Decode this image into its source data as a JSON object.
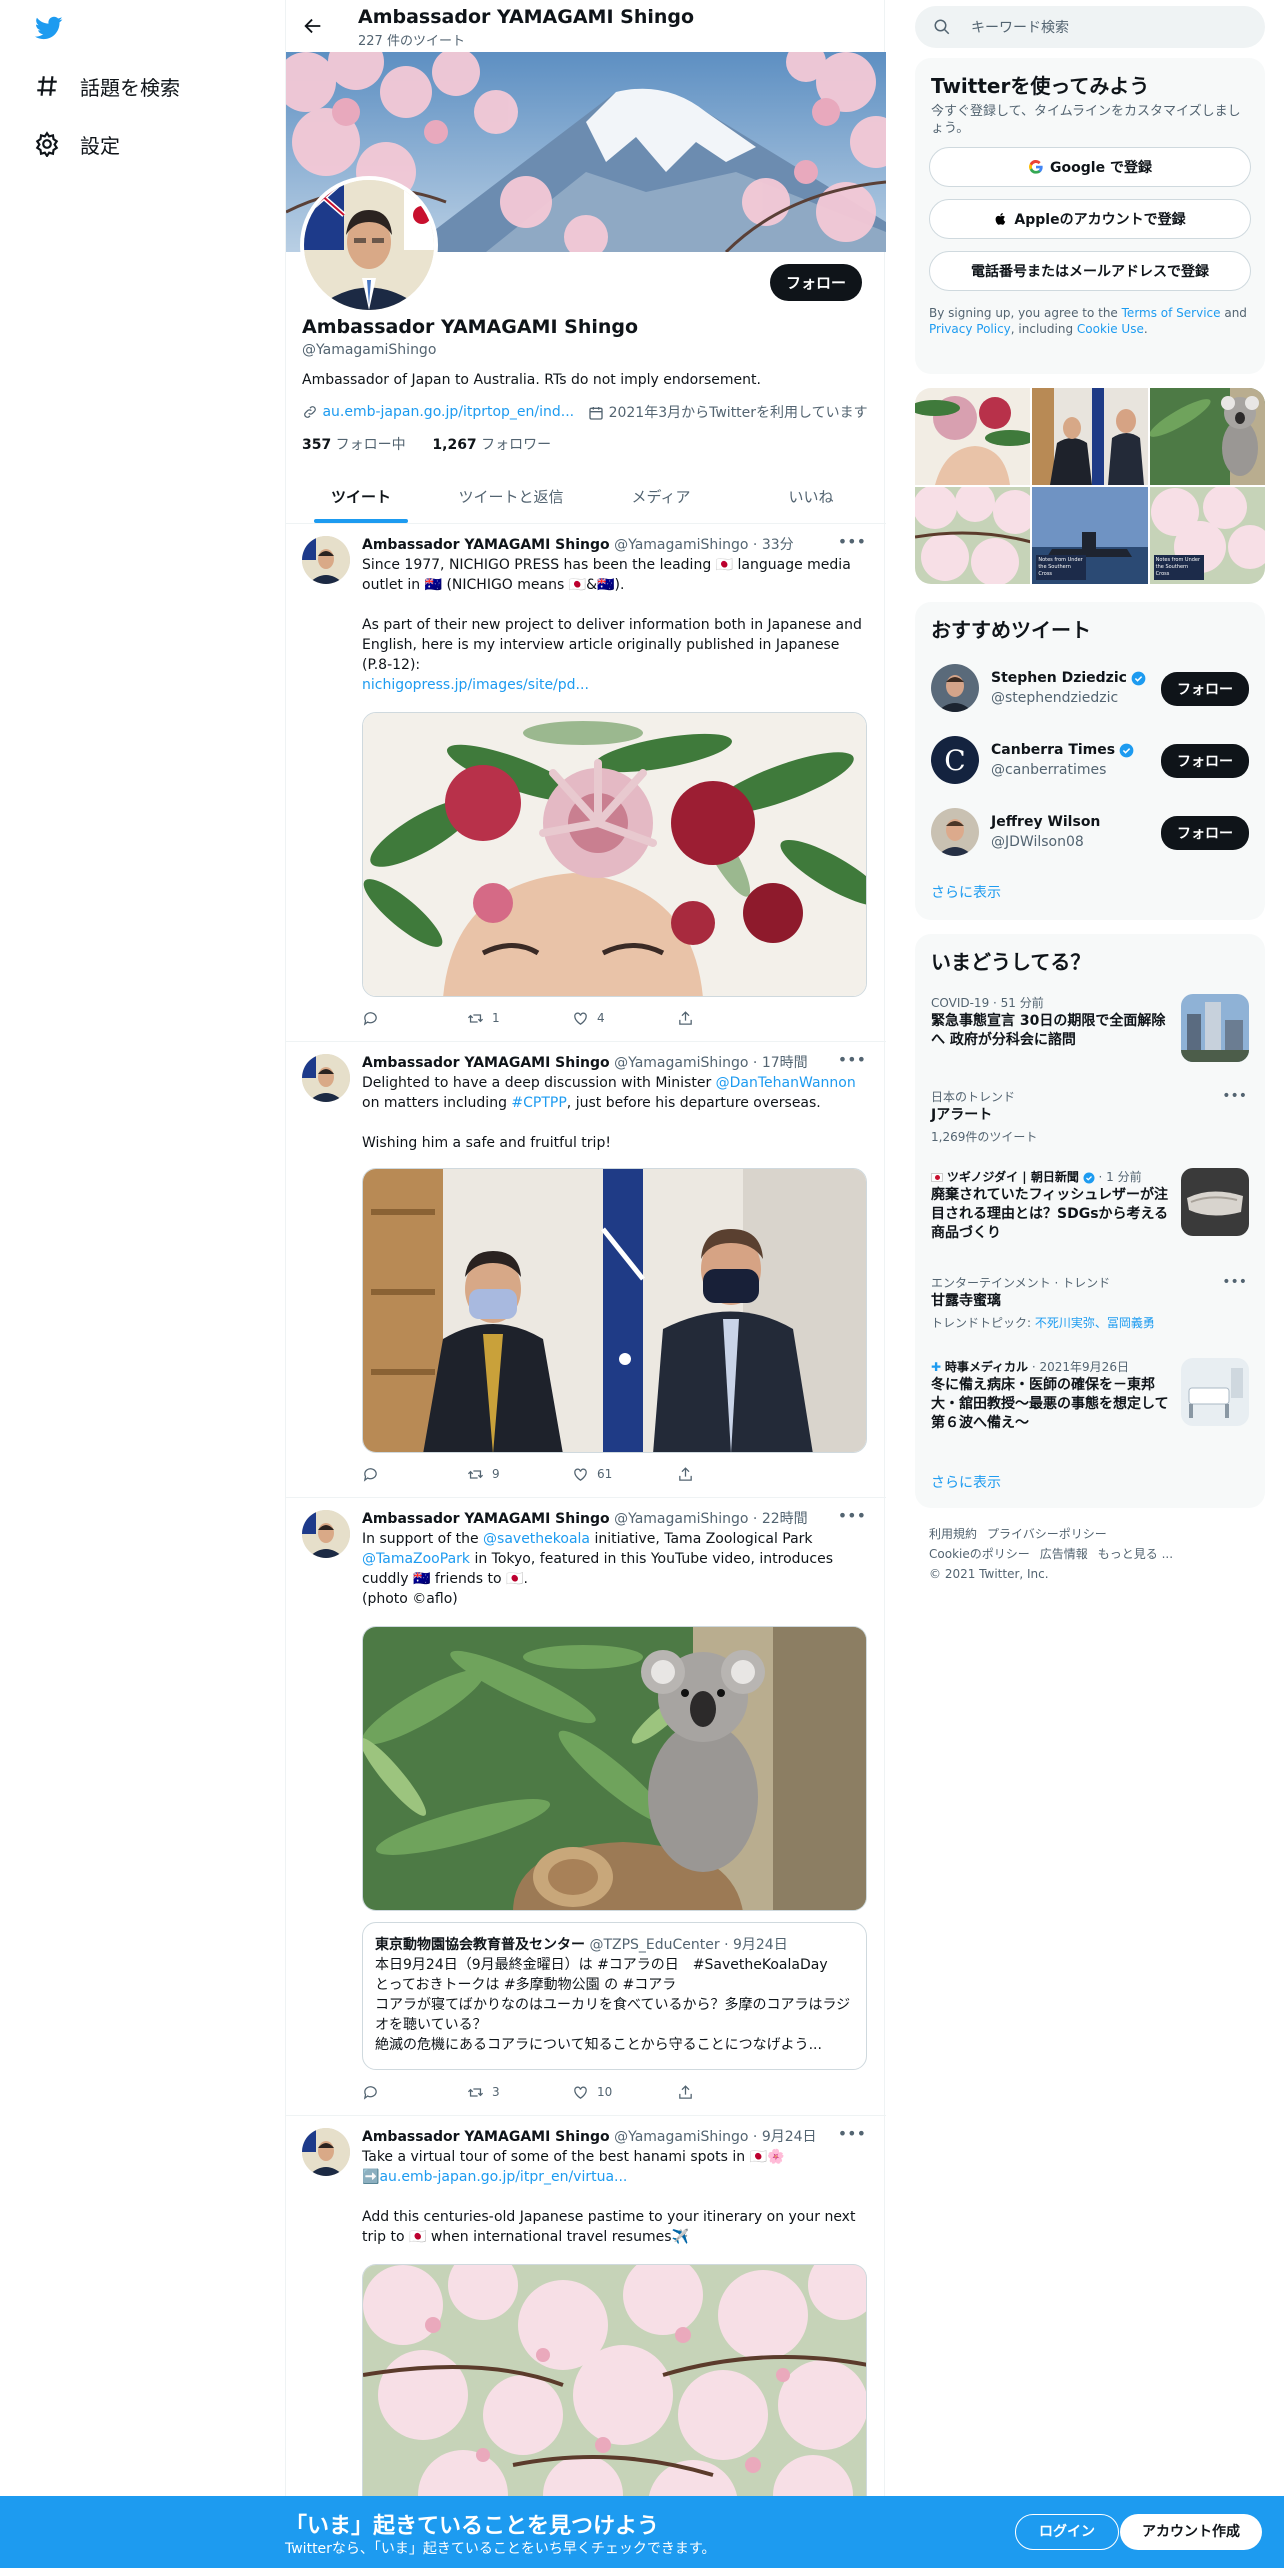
{
  "nav": {
    "explore": "話題を検索",
    "settings": "設定"
  },
  "profile": {
    "header_name": "Ambassador YAMAGAMI Shingo",
    "tweet_count": "227 件のツイート",
    "follow_button": "フォロー",
    "name": "Ambassador YAMAGAMI Shingo",
    "handle": "@YamagamiShingo",
    "bio": "Ambassador of Japan to Australia. RTs do not imply endorsement.",
    "website": "au.emb-japan.go.jp/itprtop_en/ind...",
    "joined": "2021年3月からTwitterを利用しています",
    "following_count": "357",
    "following_label": " フォロー中",
    "followers_count": "1,267",
    "followers_label": " フォロワー"
  },
  "tabs": [
    "ツイート",
    "ツイートと返信",
    "メディア",
    "いいね"
  ],
  "tweets": [
    {
      "name": "Ambassador YAMAGAMI Shingo",
      "meta": " @YamagamiShingo · 33分",
      "text": "Since 1977, NICHIGO PRESS has been the leading 🇯🇵 language media outlet in 🇦🇺 (NICHIGO means 🇯🇵&🇦🇺).\n\nAs part of their new project to deliver information both in Japanese and English, here is my interview article originally published in Japanese (P.8-12):",
      "link": "nichigopress.jp/images/site/pd...",
      "replies": "",
      "retweets": "1",
      "likes": "4"
    },
    {
      "name": "Ambassador YAMAGAMI Shingo",
      "meta": " @YamagamiShingo · 17時間",
      "text_a": "Delighted to have a deep discussion with Minister ",
      "mention": "@DanTehanWannon",
      "text_b": " on matters including ",
      "hashtag": "#CPTPP",
      "text_c": ", just before his departure overseas.\n\nWishing him a safe and fruitful trip!",
      "replies": "",
      "retweets": "9",
      "likes": "61"
    },
    {
      "name": "Ambassador YAMAGAMI Shingo",
      "meta": " @YamagamiShingo · 22時間",
      "text_a": "In support of the ",
      "mention1": "@savethekoala",
      "text_b": " initiative, Tama Zoological Park ",
      "mention2": "@TamaZooPark",
      "text_c": " in Tokyo, featured in this YouTube video, introduces cuddly 🇦🇺 friends to 🇯🇵.\n(photo ©aflo)",
      "quote_name": "東京動物園協会教育普及センター",
      "quote_meta": " @TZPS_EduCenter · 9月24日",
      "quote_text": "本日9月24日（9月最終金曜日）は #コアラの日　#SavetheKoalaDay\nとっておきトークは #多摩動物公園 の #コアラ\nコアラが寝てばかりなのはユーカリを食べているから？多摩のコアラはラジオを聴いている？\n絶滅の危機にあるコアラについて知ることから守ることにつなげよう...",
      "replies": "",
      "retweets": "3",
      "likes": "10"
    },
    {
      "name": "Ambassador YAMAGAMI Shingo",
      "meta": " @YamagamiShingo · 9月24日",
      "text_a": "Take a virtual tour of some of the best hanami spots in 🇯🇵🌸\n➡️",
      "link": "au.emb-japan.go.jp/itpr_en/virtua...",
      "text_c": "\n\nAdd this centuries-old Japanese pastime to your itinerary on your next trip to 🇯🇵 when international travel resumes✈️"
    }
  ],
  "sidebar": {
    "search_placeholder": "キーワード検索",
    "signup_title": "Twitterを使ってみよう",
    "signup_sub": "今すぐ登録して、タイムラインをカスタマイズしましょう。",
    "google_btn": "Google で登録",
    "apple_btn": "Appleのアカウントで登録",
    "phone_btn": "電話番号またはメールアドレスで登録",
    "terms_a": "By signing up, you agree to the ",
    "terms_link1": "Terms of Service",
    "terms_b": " and ",
    "terms_link2": "Privacy Policy",
    "terms_c": ", including ",
    "terms_link3": "Cookie Use",
    "terms_d": ".",
    "media_text_1": "Notes from Under the Southern Cross",
    "media_text_2": "Notes from Under the Southern Cross",
    "rec_title": "おすすめツイート",
    "recs": [
      {
        "name": "Stephen Dziedzic",
        "handle": "@stephendziedzic",
        "button": "フォロー"
      },
      {
        "name": "Canberra Times",
        "handle": "@canberratimes",
        "button": "フォロー"
      },
      {
        "name": "Jeffrey Wilson",
        "handle": "@JDWilson08",
        "button": "フォロー"
      }
    ],
    "show_more": "さらに表示",
    "trends_title": "いまどうしてる？",
    "trends": [
      {
        "context": "COVID-19 · 51 分前",
        "title": "緊急事態宣言 30日の期限で全面解除へ 政府が分科会に諮問"
      },
      {
        "context": "日本のトレンド",
        "title": "Jアラート",
        "sub": "1,269件のツイート"
      },
      {
        "context": "ツギノジダイ | 朝日新聞",
        "context_time": " · 1 分前",
        "title": "廃棄されていたフィッシュレザーが注目される理由とは？SDGsから考える商品づくり"
      },
      {
        "context": "エンターテインメント · トレンド",
        "title": "甘露寺蜜璃",
        "sub_a": "トレンドトピック: ",
        "sub_link": "不死川実弥、冨岡義勇"
      },
      {
        "context": "時事メディカル",
        "context_time": " · 2021年9月26日",
        "title": "冬に備え病床・医師の確保を－東邦大・舘田教授～最悪の事態を想定して第６波へ備え～"
      }
    ],
    "show_more_2": "さらに表示",
    "footer": [
      "利用規約",
      "プライバシーポリシー",
      "Cookieのポリシー",
      "広告情報",
      "もっと見る ...",
      "© 2021 Twitter, Inc."
    ]
  },
  "bottom_bar": {
    "title": "「いま」起きていることを見つけよう",
    "subtitle": "Twitterなら、「いま」起きていることをいち早くチェックできます。",
    "login": "ログイン",
    "signup": "アカウント作成"
  },
  "colors": {
    "accent": "#1d9bf0",
    "text": "#0f1419",
    "muted": "#536471"
  }
}
